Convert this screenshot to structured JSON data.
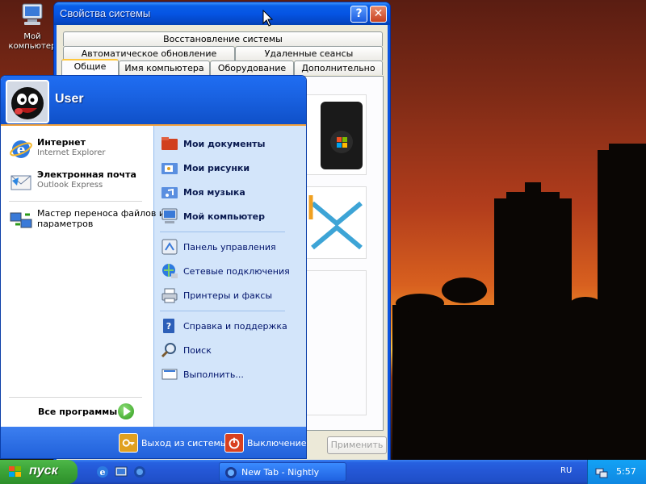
{
  "desktop": {
    "icons": [
      {
        "label": "Мой компьютер",
        "icon": "my-computer-icon"
      }
    ]
  },
  "window": {
    "title": "Свойства системы",
    "help_symbol": "?",
    "close_symbol": "✕",
    "tabs_row1": [
      "Восстановление системы"
    ],
    "tabs_row2": [
      "Автоматическое обновление",
      "Удаленные сеансы"
    ],
    "tabs_row3": [
      "Общие",
      "Имя компьютера",
      "Оборудование",
      "Дополнительно"
    ],
    "active_tab": "Общие",
    "apply_label": "Применить"
  },
  "start_menu": {
    "user_name": "User",
    "pinned": [
      {
        "title": "Интернет",
        "subtitle": "Internet Explorer",
        "icon": "internet-explorer-icon"
      },
      {
        "title": "Электронная почта",
        "subtitle": "Outlook Express",
        "icon": "outlook-express-icon"
      }
    ],
    "recent": [
      {
        "line1": "Мастер переноса файлов и",
        "line2": "параметров",
        "icon": "transfer-wizard-icon"
      }
    ],
    "all_programs_label": "Все программы",
    "right_bold": [
      {
        "label": "Мои документы",
        "icon": "my-documents-icon"
      },
      {
        "label": "Мои рисунки",
        "icon": "my-pictures-icon"
      },
      {
        "label": "Моя музыка",
        "icon": "my-music-icon"
      },
      {
        "label": "Мой компьютер",
        "icon": "my-computer-icon"
      }
    ],
    "right_group2": [
      {
        "label": "Панель управления",
        "icon": "control-panel-icon"
      },
      {
        "label": "Сетевые подключения",
        "icon": "network-connections-icon"
      },
      {
        "label": "Принтеры и факсы",
        "icon": "printers-icon"
      }
    ],
    "right_group3": [
      {
        "label": "Справка и поддержка",
        "icon": "help-icon"
      },
      {
        "label": "Поиск",
        "icon": "search-icon"
      },
      {
        "label": "Выполнить...",
        "icon": "run-icon"
      }
    ],
    "logoff_label": "Выход из системы",
    "shutdown_label": "Выключение"
  },
  "taskbar": {
    "start_label": "пуск",
    "task_label": "New Tab - Nightly",
    "language": "RU",
    "clock": "5:57"
  }
}
